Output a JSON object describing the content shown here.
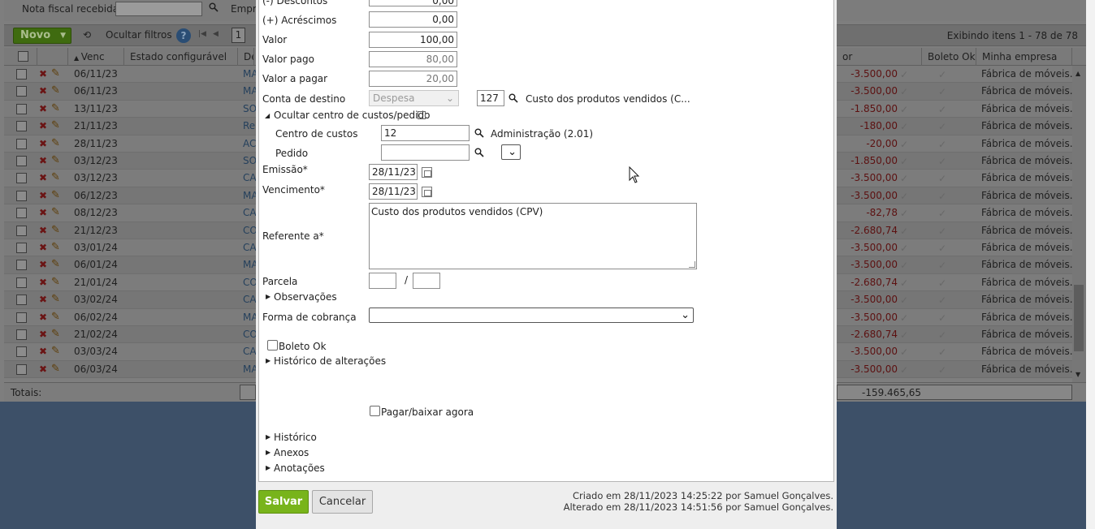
{
  "filter_bar": {
    "label": "Nota fiscal recebida",
    "empresa_label": "Empre"
  },
  "toolbar": {
    "new_label": "Novo",
    "hide_filters_label": "Ocultar filtros",
    "help_label": "?",
    "page_value": "1",
    "items_info": "Exibindo itens 1 - 78 de 78"
  },
  "grid": {
    "columns": {
      "venc": "Venc",
      "estado": "Estado configurável",
      "desc": "De",
      "valor": "or",
      "boleto_ok": "Boleto Ok",
      "empresa": "Minha empresa"
    },
    "rows": [
      {
        "venc": "06/11/23",
        "desc": "MA",
        "valor": "-3.500,00",
        "empresa": "Fábrica de móveis..."
      },
      {
        "venc": "06/11/23",
        "desc": "MA",
        "valor": "-3.500,00",
        "empresa": "Fábrica de móveis..."
      },
      {
        "venc": "13/11/23",
        "desc": "SO",
        "valor": "-1.850,00",
        "empresa": "Fábrica de móveis..."
      },
      {
        "venc": "21/11/23",
        "desc": "Re",
        "valor": "-180,00",
        "empresa": "Fábrica de móveis..."
      },
      {
        "venc": "28/11/23",
        "desc": "AC",
        "valor": "-20,00",
        "empresa": "Fábrica de móveis..."
      },
      {
        "venc": "03/12/23",
        "desc": "SO",
        "valor": "-1.850,00",
        "empresa": "Fábrica de móveis..."
      },
      {
        "venc": "03/12/23",
        "desc": "CA",
        "valor": "-3.500,00",
        "empresa": "Fábrica de móveis..."
      },
      {
        "venc": "06/12/23",
        "desc": "MA",
        "valor": "-3.500,00",
        "empresa": "Fábrica de móveis..."
      },
      {
        "venc": "08/12/23",
        "desc": "CA",
        "valor": "-82,78",
        "empresa": "Fábrica de móveis..."
      },
      {
        "venc": "21/12/23",
        "desc": "CO",
        "valor": "-2.680,74",
        "empresa": "Fábrica de móveis..."
      },
      {
        "venc": "03/01/24",
        "desc": "CA",
        "valor": "-3.500,00",
        "empresa": "Fábrica de móveis..."
      },
      {
        "venc": "06/01/24",
        "desc": "MA",
        "valor": "-3.500,00",
        "empresa": "Fábrica de móveis..."
      },
      {
        "venc": "21/01/24",
        "desc": "CO",
        "valor": "-2.680,74",
        "empresa": "Fábrica de móveis..."
      },
      {
        "venc": "03/02/24",
        "desc": "CA",
        "valor": "-3.500,00",
        "empresa": "Fábrica de móveis..."
      },
      {
        "venc": "06/02/24",
        "desc": "MA",
        "valor": "-3.500,00",
        "empresa": "Fábrica de móveis..."
      },
      {
        "venc": "21/02/24",
        "desc": "CO",
        "valor": "-2.680,74",
        "empresa": "Fábrica de móveis..."
      },
      {
        "venc": "03/03/24",
        "desc": "CA",
        "valor": "-3.500,00",
        "empresa": "Fábrica de móveis..."
      },
      {
        "venc": "06/03/24",
        "desc": "MA",
        "valor": "-3.500,00",
        "empresa": "Fábrica de móveis..."
      }
    ],
    "totals_label": "Totais:",
    "totals_value": "-159.465,65"
  },
  "form": {
    "descontos_label": "(-) Descontos",
    "descontos_value": "0,00",
    "acrescimos_label": "(+) Acréscimos",
    "acrescimos_value": "0,00",
    "valor_label": "Valor",
    "valor_value": "100,00",
    "valor_pago_label": "Valor pago",
    "valor_pago_value": "80,00",
    "valor_a_pagar_label": "Valor a pagar",
    "valor_a_pagar_value": "20,00",
    "conta_destino_label": "Conta de destino",
    "conta_tipo_value": "Despesa",
    "conta_codigo_value": "127",
    "conta_descricao": "Custo dos produtos vendidos (C...",
    "ocultar_centro_label": "Ocultar centro de custos/pedido",
    "centro_custos_label": "Centro de custos",
    "centro_custos_value": "12",
    "centro_custos_descricao": "Administração (2.01)",
    "pedido_label": "Pedido",
    "pedido_value": "",
    "emissao_label": "Emissão*",
    "emissao_value": "28/11/23",
    "vencimento_label": "Vencimento*",
    "vencimento_value": "28/11/23",
    "referente_label": "Referente a*",
    "referente_value": "Custo dos produtos vendidos (CPV)",
    "parcela_label": "Parcela",
    "parcela_sep": "/",
    "observacoes_label": "Observações",
    "forma_cobranca_label": "Forma de cobrança",
    "forma_cobranca_value": "",
    "boleto_ok_label": "Boleto Ok",
    "historico_alteracoes_label": "Histórico de alterações",
    "pagar_baixar_label": "Pagar/baixar agora",
    "historico_label": "Histórico",
    "anexos_label": "Anexos",
    "anotacoes_label": "Anotações"
  },
  "footer": {
    "save_label": "Salvar",
    "cancel_label": "Cancelar",
    "created_text": "Criado em 28/11/2023 14:25:22 por Samuel Gonçalves.",
    "altered_text": "Alterado em 28/11/2023 14:51:56 por Samuel Gonçalves."
  },
  "colors": {
    "accent_green": "#78b41b",
    "negative_red": "#c00000",
    "page_bg": "#3d5068"
  }
}
